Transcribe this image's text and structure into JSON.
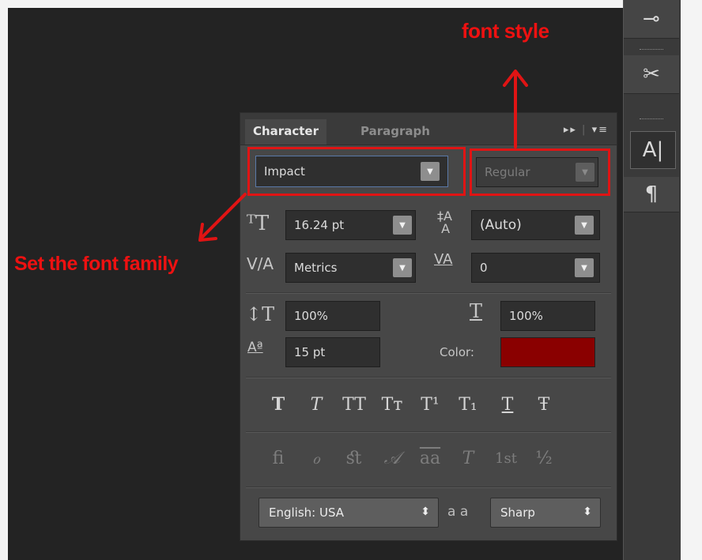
{
  "annotations": {
    "font_style_label": "font style",
    "font_family_label": "Set the font family"
  },
  "tabs": [
    {
      "label": "Character",
      "active": true
    },
    {
      "label": "Paragraph",
      "active": false
    }
  ],
  "panel_controls": {
    "expand_icon": "double-arrow",
    "menu_icon": "panel-menu"
  },
  "font_family": {
    "value": "Impact"
  },
  "font_style": {
    "value": "Regular",
    "enabled": false
  },
  "font_size": {
    "value": "16.24 pt",
    "icon": "font-size-icon"
  },
  "leading": {
    "value": "(Auto)",
    "icon": "leading-icon"
  },
  "kerning": {
    "value": "Metrics",
    "icon": "kerning-icon"
  },
  "tracking": {
    "value": "0",
    "icon": "tracking-icon"
  },
  "vertical_scale": {
    "value": "100%",
    "icon": "vertical-scale-icon"
  },
  "horizontal_scale": {
    "value": "100%",
    "icon": "horizontal-scale-icon"
  },
  "baseline_shift": {
    "value": "15 pt",
    "icon": "baseline-shift-icon"
  },
  "color": {
    "label": "Color:",
    "swatch": "#8a0000"
  },
  "style_buttons": [
    "T",
    "T",
    "TT",
    "Tт",
    "T¹",
    "T₁",
    "T",
    "Ŧ"
  ],
  "opentype_buttons": [
    "ﬁ",
    "ℴ",
    "ﬆ",
    "𝒜",
    "aa",
    "T",
    "1st",
    "½"
  ],
  "language": {
    "value": "English: USA"
  },
  "antialias": {
    "icon_text": "a a",
    "value": "Sharp"
  },
  "accent_color": "#e01414"
}
